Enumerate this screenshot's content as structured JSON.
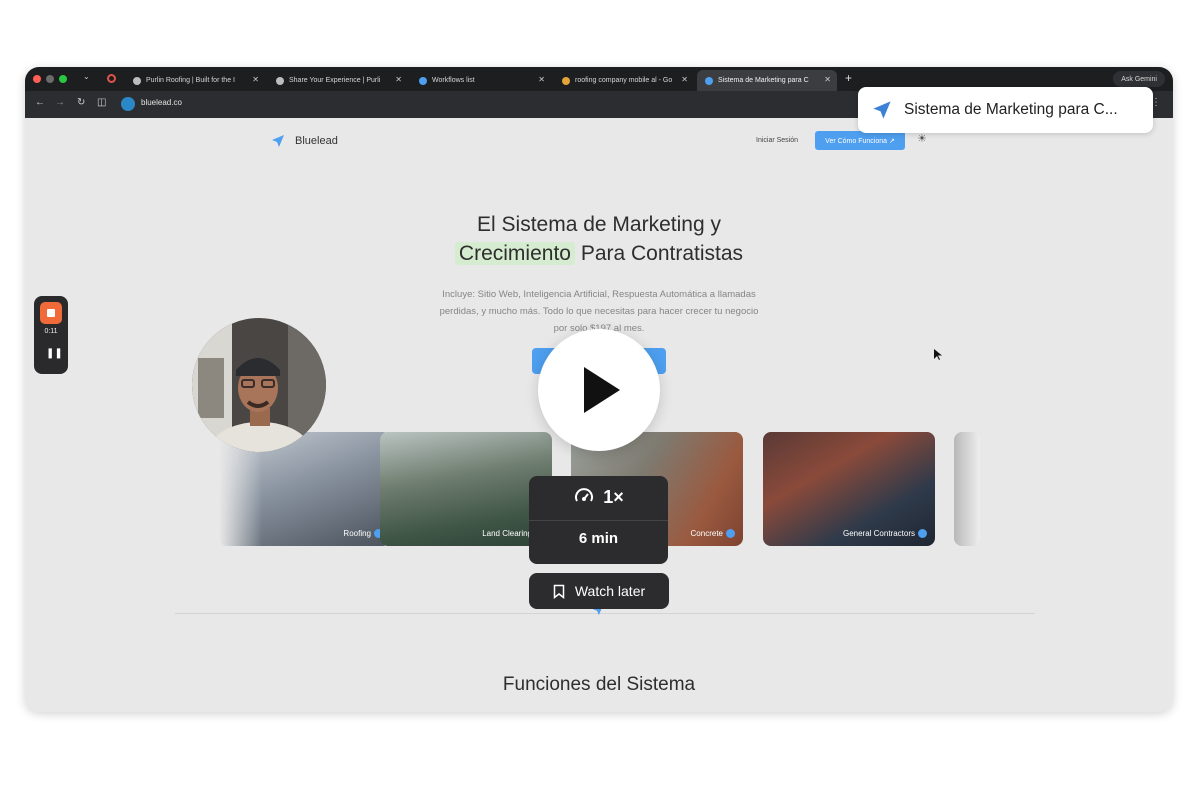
{
  "browser": {
    "tabs": [
      {
        "title": "Purlin Roofing | Built for the I"
      },
      {
        "title": "Share Your Experience | Purli"
      },
      {
        "title": "Workflows list"
      },
      {
        "title": "roofing company mobile al - Go"
      },
      {
        "title": "Sistema de Marketing para C"
      }
    ],
    "ask_gemini": "Ask Gemini",
    "url": "bluelead.co"
  },
  "site": {
    "brand": "Bluelead",
    "login": "Iniciar Sesión",
    "cta": "Ver Cómo Funciona ↗",
    "hero_line1": "El Sistema de Marketing y",
    "hero_highlight": "Crecimiento",
    "hero_line2_rest": "Para Contratistas",
    "subtext": "Incluye: Sitio Web, Inteligencia Artificial, Respuesta Automática a llamadas perdidas, y mucho más. Todo lo que necesitas para hacer crecer tu negocio por solo $197 al mes.",
    "cards": [
      {
        "label": "Roofing"
      },
      {
        "label": "Land Clearing"
      },
      {
        "label": "Concrete"
      },
      {
        "label": "General Contractors"
      }
    ],
    "section_title": "Funciones del Sistema"
  },
  "recorder": {
    "time": "0:11"
  },
  "video": {
    "title": "Sistema de Marketing para C...",
    "speed": "1×",
    "duration": "6 min",
    "watch_later": "Watch later"
  },
  "colors": {
    "accent": "#4e9ff0",
    "recorder_stop": "#f16a3a",
    "highlight": "#d6ecd0"
  }
}
